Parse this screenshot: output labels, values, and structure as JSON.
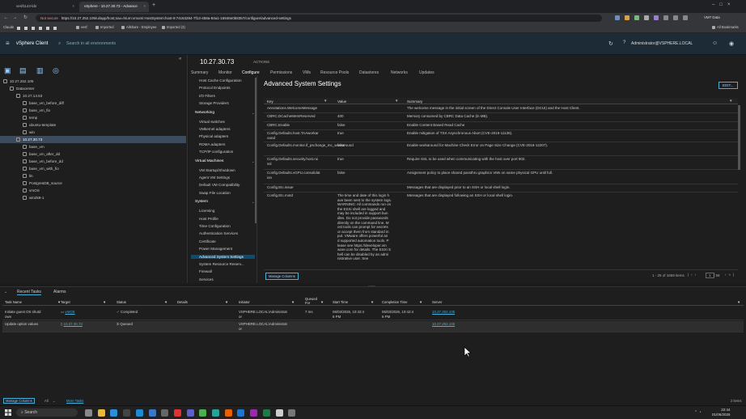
{
  "browser": {
    "tabs": [
      {
        "label": "vesf1144-lds"
      },
      {
        "label": "vSphere - 10.27.30.73 - Advance"
      }
    ],
    "url_warning": "Not secure",
    "url": "https://10.27.252.105/ui/app/host;nav=h/urn:vmomi:HostSystem:host-9:74c63284-7f13-458a-84a1-16946e0b8357/configure/advanced-settings",
    "bookmarks": [
      "Claude",
      "vesf",
      "Imported",
      "Allshare - Employee",
      "Imported (3)"
    ],
    "all_bookmarks": "All Bookmarks",
    "profile": "VMT Data"
  },
  "vsphere": {
    "brand": "vSphere Client",
    "search_placeholder": "Search in all environments",
    "user": "Administrator@VSPHERE.LOCAL"
  },
  "tree": [
    {
      "label": "10.27.252.105",
      "indent": 0
    },
    {
      "label": "Datacenter",
      "indent": 1
    },
    {
      "label": "10.27.14.53",
      "indent": 2
    },
    {
      "label": "base_vm_before_diff",
      "indent": 3
    },
    {
      "label": "base_vm_fio",
      "indent": 3
    },
    {
      "label": "temp",
      "indent": 3
    },
    {
      "label": "ubuntu-template",
      "indent": 3
    },
    {
      "label": "win",
      "indent": 3
    },
    {
      "label": "10.27.30.73",
      "indent": 2,
      "selected": true
    },
    {
      "label": "base_vm",
      "indent": 3
    },
    {
      "label": "base_vm_after_dd",
      "indent": 3
    },
    {
      "label": "base_vm_before_dd",
      "indent": 3
    },
    {
      "label": "base_vm_with_fio",
      "indent": 3
    },
    {
      "label": "lin",
      "indent": 3
    },
    {
      "label": "PostgresDB_source",
      "indent": 3
    },
    {
      "label": "vmOS",
      "indent": 3
    },
    {
      "label": "win2k9-1",
      "indent": 3
    }
  ],
  "object": {
    "title": "10.27.30.73",
    "actions": "ACTIONS",
    "tabs": [
      "Summary",
      "Monitor",
      "Configure",
      "Permissions",
      "VMs",
      "Resource Pools",
      "Datastores",
      "Networks",
      "Updates"
    ]
  },
  "config_nav": [
    {
      "type": "item",
      "label": "Host Cache Configuration"
    },
    {
      "type": "item",
      "label": "Protocol Endpoints"
    },
    {
      "type": "item",
      "label": "I/O Filters"
    },
    {
      "type": "item",
      "label": "Storage Providers"
    },
    {
      "type": "section",
      "label": "Networking"
    },
    {
      "type": "item",
      "label": "Virtual switches"
    },
    {
      "type": "item",
      "label": "VMkernel adapters"
    },
    {
      "type": "item",
      "label": "Physical adapters"
    },
    {
      "type": "item",
      "label": "RDMA adapters"
    },
    {
      "type": "item",
      "label": "TCP/IP configuration"
    },
    {
      "type": "section",
      "label": "Virtual Machines"
    },
    {
      "type": "item",
      "label": "VM Startup/Shutdown"
    },
    {
      "type": "item",
      "label": "Agent VM Settings"
    },
    {
      "type": "item",
      "label": "Default VM Compatibility"
    },
    {
      "type": "item",
      "label": "Swap File Location"
    },
    {
      "type": "section",
      "label": "System"
    },
    {
      "type": "item",
      "label": "Licensing"
    },
    {
      "type": "item",
      "label": "Host Profile"
    },
    {
      "type": "item",
      "label": "Time Configuration"
    },
    {
      "type": "item",
      "label": "Authentication Services"
    },
    {
      "type": "item",
      "label": "Certificate"
    },
    {
      "type": "item",
      "label": "Power Management"
    },
    {
      "type": "item",
      "label": "Advanced System Settings",
      "selected": true
    },
    {
      "type": "item",
      "label": "System Resource Reserv..."
    },
    {
      "type": "item",
      "label": "Firewall"
    },
    {
      "type": "item",
      "label": "Services"
    }
  ],
  "settings": {
    "title": "Advanced System Settings",
    "edit": "EDIT...",
    "columns": [
      "Key",
      "Value",
      "Summary"
    ],
    "rows": [
      {
        "key": "Annotations.WelcomeMessage",
        "value": "",
        "summary": "The welcome message in the initial screen of the Direct Console User Interface (DCUI) and the Host Client."
      },
      {
        "key": "CBRC.DCacheMemReserved",
        "value": "400",
        "summary": "Memory consumed by CBRC Data Cache (in MB)."
      },
      {
        "key": "CBRC.Enable",
        "value": "false",
        "summary": "Enable Content Based Read Cache"
      },
      {
        "key": "Config.Defaults.host.TAAworkar\nound",
        "value": "true",
        "summary": "Enable mitigation of TSX Asynchronous Abort (CVE-2019-11135)."
      },
      {
        "key": "Config.Defaults.monitor.if_pschange_mc_workaround",
        "value": "false",
        "summary": "Enable workaround for Machine Check Error on Page Size Change (CVE-2018-12207)."
      },
      {
        "key": "Config.Defaults.security.host.rui\nssl",
        "value": "true",
        "summary": "Require SSL to be used when communicating with the host over port 902."
      },
      {
        "key": "Config.Defaults.vGPU.consolidat\nion",
        "value": "false",
        "summary": "Assignment policy to place shared passthru graphics VMs on same physical GPU until full."
      },
      {
        "key": "Config.Etc.issue",
        "value": "",
        "summary": "Messages that are displayed prior to an SSH or local shell login."
      },
      {
        "key": "Config.Etc.motd",
        "value": "The time and date of this login h\nave been sent to the system logs.\nWARNING: All commands run on\nthe ESXi shell are logged and\nmay be included in support bun\ndles. Do not provide passwords\ndirectly on the command line. M\nost tools can prompt for secrets\nor accept them from standard in\nput. VMware offers powerful an\nd supported automation tools. P\nlease see https://developer.vm\nware.com for details. The ESXi S\nhell can be disabled by an admi\nnistrative user. See",
        "summary": "Messages that are displayed following an SSH or local shell login."
      }
    ],
    "manage_columns": "Manage Columns",
    "pagination": "1 - 25 of 1659 items",
    "page": "1",
    "pages": "/ 58"
  },
  "tasks": {
    "tabs": [
      "Recent Tasks",
      "Alarms"
    ],
    "columns": [
      "Task Name",
      "Target",
      "Status",
      "Details",
      "Initiator",
      "Queued For",
      "Start Time",
      "Completion Time",
      "Server"
    ],
    "rows": [
      {
        "task": "Initiate guest OS shutd\nown",
        "target": "vmOS",
        "status": "Completed",
        "details": "",
        "initiator": "VSPHERE.LOCAL\\Administrat\nor",
        "queued": "7 ms",
        "start": "06/03/2026, 10:42:4\n6 PM",
        "completion": "06/03/2026, 10:42:4\n6 PM",
        "server": "10.27.252.105"
      },
      {
        "task": "Update option values",
        "target": "10.27.30.73",
        "status": "Queued",
        "details": "",
        "initiator": "VSPHERE.LOCAL\\Administrat\nor",
        "queued": "",
        "start": "",
        "completion": "",
        "server": "10.27.252.105"
      }
    ],
    "manage_columns": "Manage Columns",
    "filter_all": "All",
    "more_tasks": "More Tasks",
    "count": "2 items"
  },
  "taskbar": {
    "search": "Search",
    "time": "22:44",
    "date": "01/06/2026"
  }
}
